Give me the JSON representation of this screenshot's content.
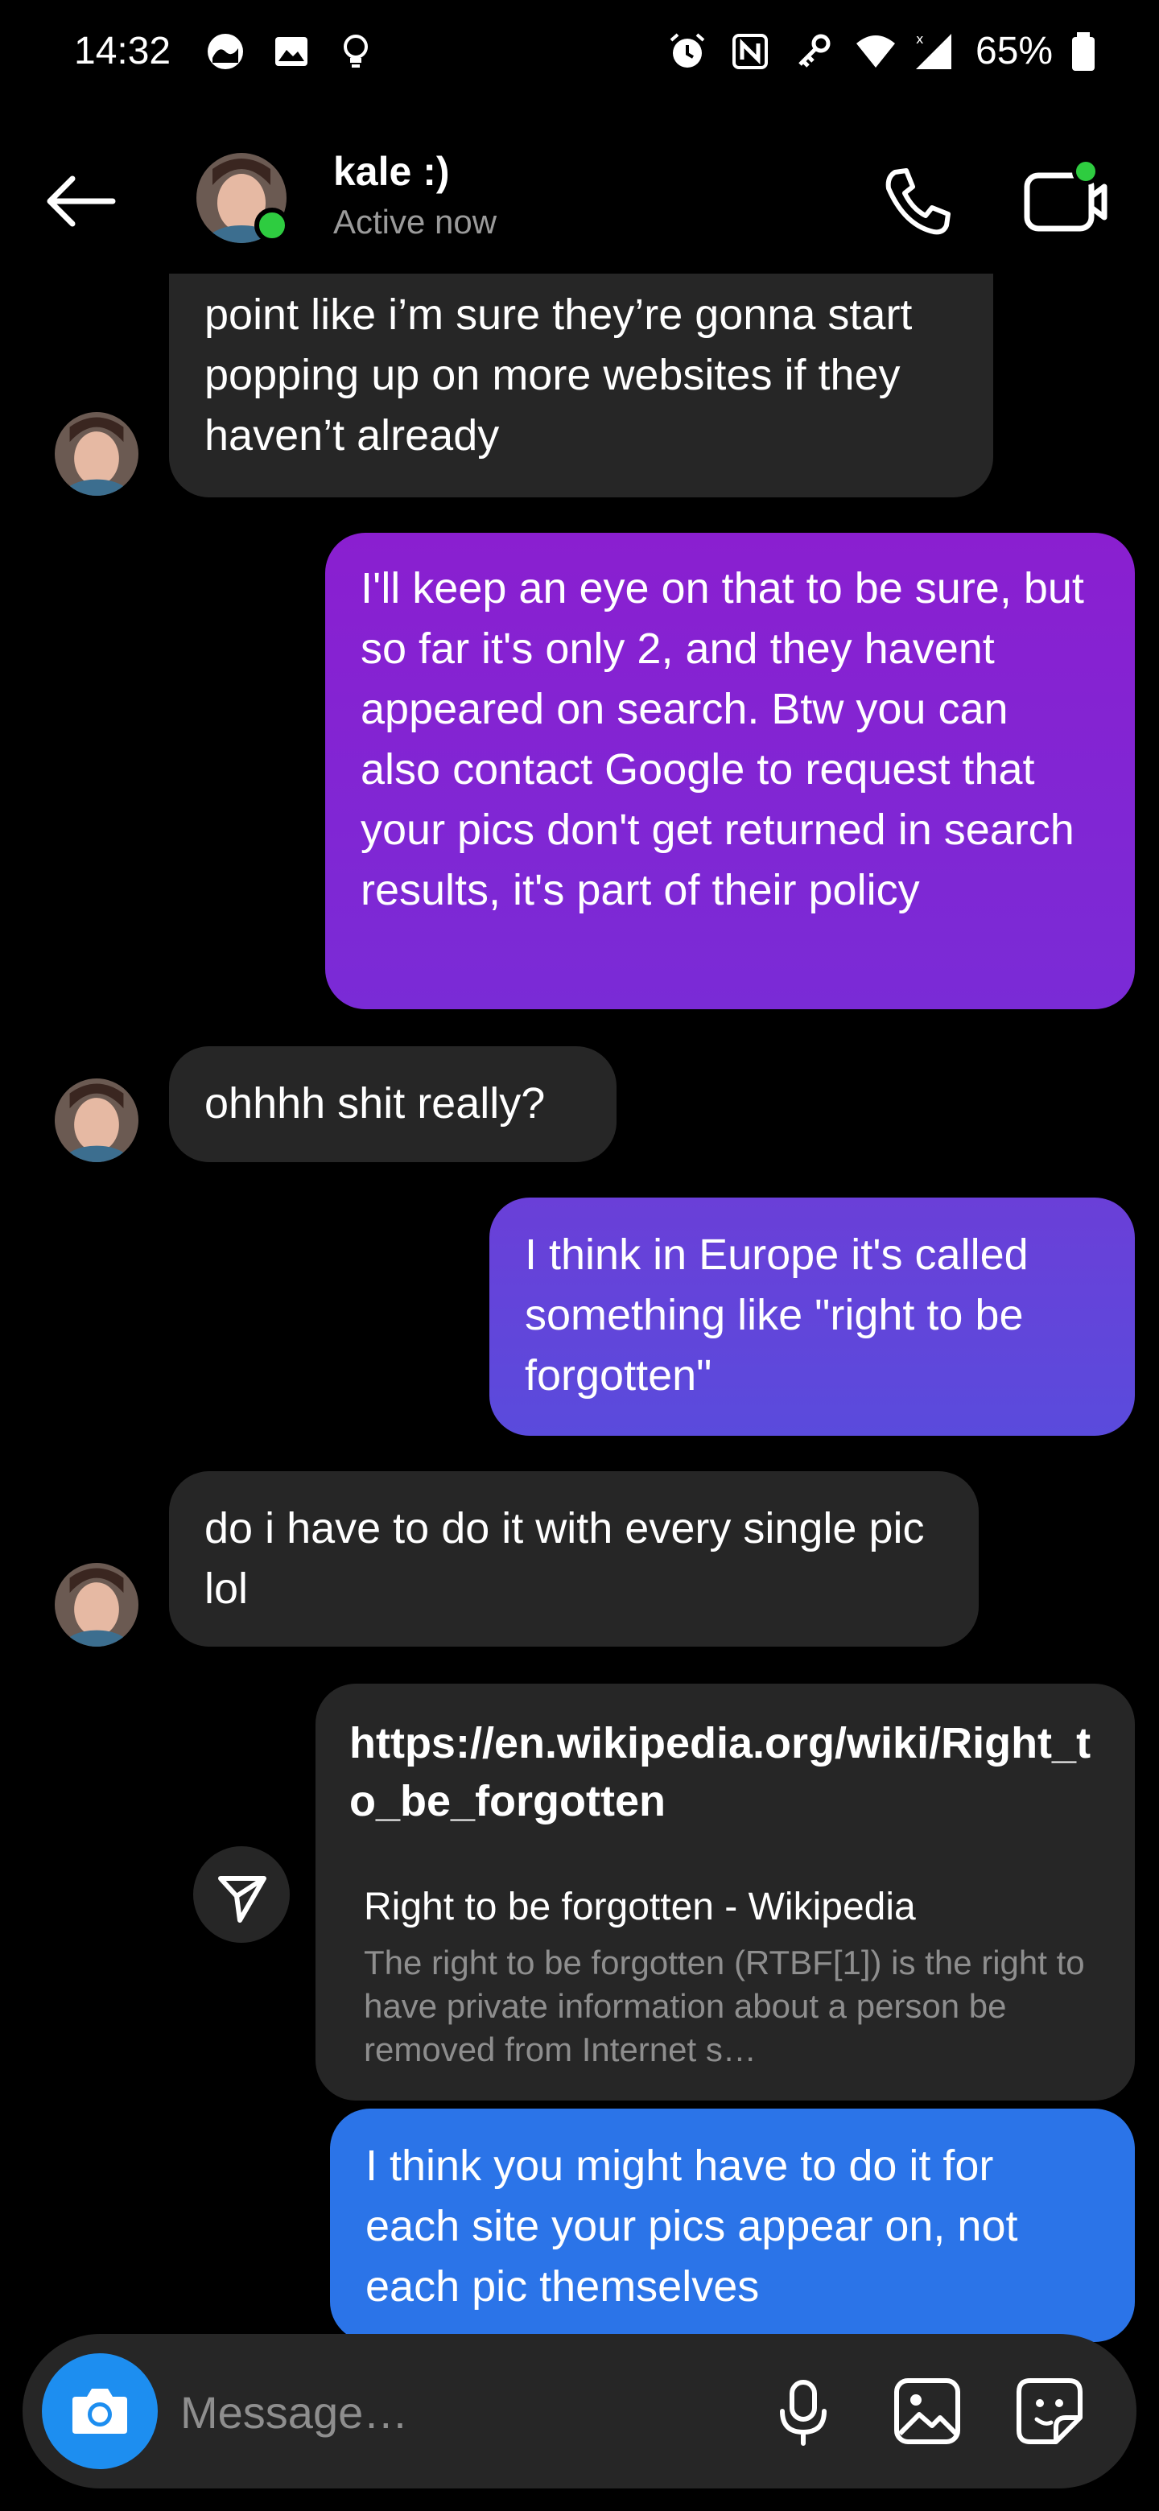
{
  "status_bar": {
    "time": "14:32",
    "battery": "65%",
    "icons": [
      "threads-icon",
      "image-icon",
      "bulb-icon",
      "alarm-icon",
      "nfc-icon",
      "key-icon",
      "wifi-icon",
      "signal-icon",
      "battery-icon"
    ]
  },
  "header": {
    "name": "kale :)",
    "status": "Active now"
  },
  "messages": [
    {
      "type": "in",
      "text": "point like i’m sure they’re gonna start popping up on more websites if they haven’t already"
    },
    {
      "type": "out",
      "text": "I'll keep an eye on that to be sure, but so far it's only 2, and they havent appeared on search. Btw you can also contact Google to request that your pics don't get returned in search results, it's part of their policy"
    },
    {
      "type": "in",
      "text": "ohhhh shit really?"
    },
    {
      "type": "out",
      "text": "I think in Europe it's called something like \"right to be forgotten\""
    },
    {
      "type": "in",
      "text": "do i have to do it with every single pic lol"
    },
    {
      "type": "out",
      "text": "I think you might have to do it for each site your pics appear on, not each pic themselves"
    }
  ],
  "link_preview": {
    "url": "https://en.wikipedia.org/wiki/Right_to_be_forgotten",
    "title": "Right to be forgotten - Wikipedia",
    "description": "The right to be forgotten (RTBF[1]) is the right to have private information about a person be removed from Internet s…"
  },
  "composer": {
    "placeholder": "Message…"
  },
  "colors": {
    "incoming_bubble": "#262626",
    "outgoing_purple": "#8a1fd0",
    "outgoing_indigo": "#5a4bdc",
    "outgoing_blue": "#2b74e8",
    "online_green": "#2ecc40",
    "camera_blue": "#1d8ef0"
  }
}
